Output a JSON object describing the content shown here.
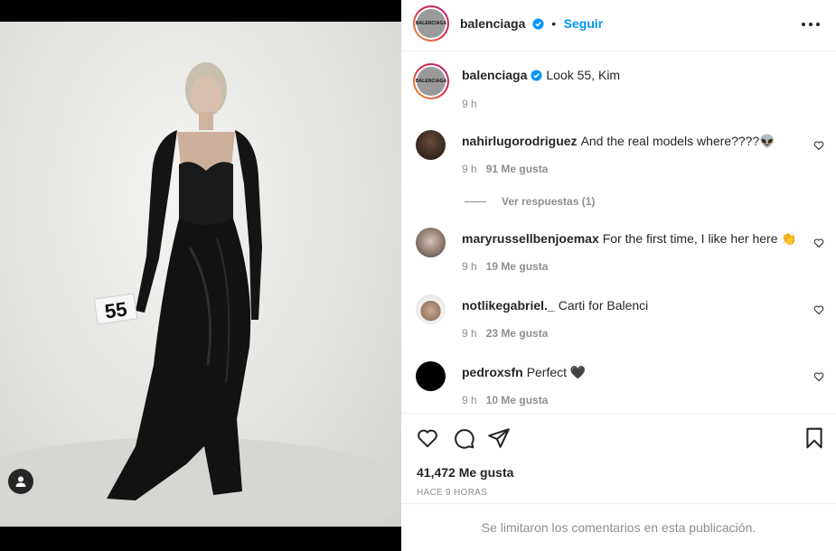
{
  "post": {
    "photo_tag_number": "55",
    "header": {
      "username": "balenciaga",
      "separator": "•",
      "follow_label": "Seguir",
      "logo_text": "BALENCIAGA"
    },
    "caption": {
      "username": "balenciaga",
      "text": "Look 55, Kim",
      "time": "9 h"
    },
    "comments": [
      {
        "username": "nahirlugorodriguez",
        "text": "And the real models where????👽",
        "time": "9 h",
        "likes": "91 Me gusta"
      },
      {
        "username": "maryrussellbenjoemax",
        "text": "For the first time, I like her here 👏",
        "time": "9 h",
        "likes": "19 Me gusta"
      },
      {
        "username": "notlikegabriel._",
        "text": "Carti for Balenci",
        "time": "9 h",
        "likes": "23 Me gusta"
      },
      {
        "username": "pedroxsfn",
        "text": "Perfect 🖤",
        "time": "9 h",
        "likes": "10 Me gusta"
      }
    ],
    "view_replies": "Ver respuestas (1)",
    "like_count": "41,472 Me gusta",
    "time_ago": "HACE 9 HORAS",
    "comments_limited": "Se limitaron los comentarios en esta publicación."
  },
  "colors": {
    "accent": "#0095f6",
    "muted": "#8e8e8e",
    "text": "#262626"
  }
}
